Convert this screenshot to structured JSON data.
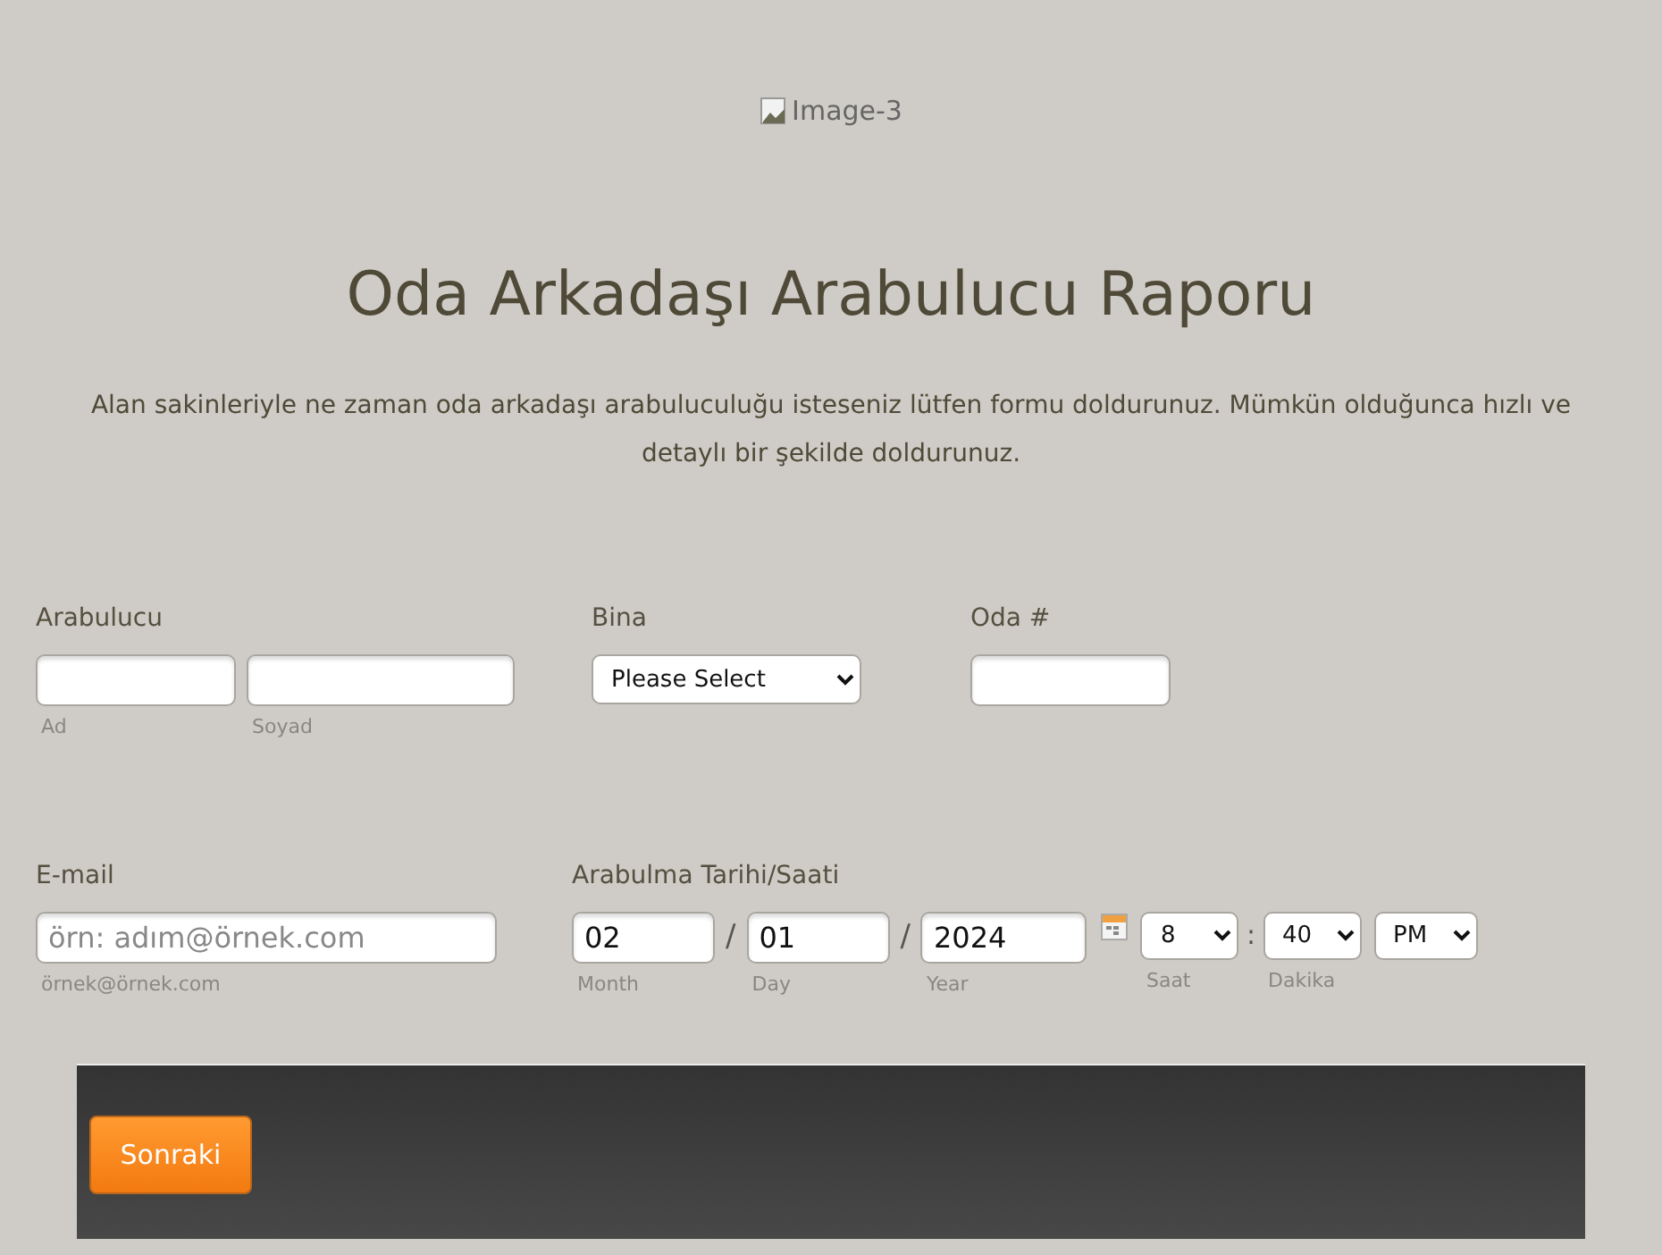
{
  "header_image": {
    "alt": "Image-3"
  },
  "title": "Oda Arkadaşı Arabulucu Raporu",
  "description": "Alan sakinleriyle ne zaman oda arkadaşı arabuluculuğu isteseniz lütfen formu doldurunuz. Mümkün olduğunca hızlı ve detaylı bir şekilde doldurunuz.",
  "arabulucu": {
    "label": "Arabulucu",
    "first": {
      "sublabel": "Ad"
    },
    "last": {
      "sublabel": "Soyad"
    }
  },
  "bina": {
    "label": "Bina",
    "value": "Please Select"
  },
  "oda": {
    "label": "Oda #"
  },
  "email": {
    "label": "E-mail",
    "placeholder": "örn: adım@örnek.com",
    "sublabel": "örnek@örnek.com"
  },
  "datetime": {
    "label": "Arabulma Tarihi/Saati",
    "separator": "/",
    "time_separator": ":",
    "month": {
      "value": "02",
      "sublabel": "Month"
    },
    "day": {
      "value": "01",
      "sublabel": "Day"
    },
    "year": {
      "value": "2024",
      "sublabel": "Year"
    },
    "hour": {
      "value": "8",
      "sublabel": "Saat"
    },
    "minute": {
      "value": "40",
      "sublabel": "Dakika"
    },
    "ampm": {
      "value": "PM"
    }
  },
  "next_button": "Sonraki"
}
